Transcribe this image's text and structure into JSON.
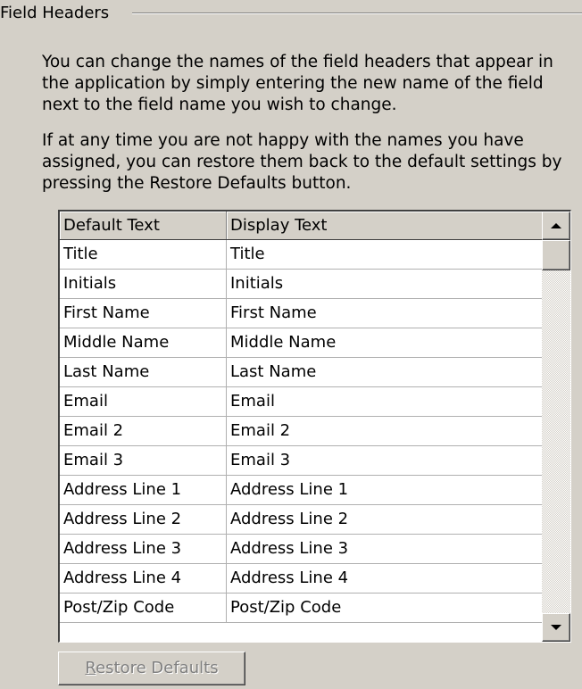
{
  "group": {
    "title": "Field Headers"
  },
  "instructions": {
    "p1": "You can change the names of the field headers that appear in\nthe application by simply entering the new name of the field\nnext to the field name you wish to change.",
    "p2": "If at any time you are not happy with the names you have\nassigned, you can restore them back to the default settings by\npressing the Restore Defaults button."
  },
  "grid": {
    "columns": [
      "Default Text",
      "Display Text"
    ],
    "rows": [
      [
        "Title",
        "Title"
      ],
      [
        "Initials",
        "Initials"
      ],
      [
        "First Name",
        "First Name"
      ],
      [
        "Middle Name",
        "Middle Name"
      ],
      [
        "Last Name",
        "Last Name"
      ],
      [
        "Email",
        "Email"
      ],
      [
        "Email 2",
        "Email 2"
      ],
      [
        "Email 3",
        "Email 3"
      ],
      [
        "Address Line 1",
        "Address Line 1"
      ],
      [
        "Address Line 2",
        "Address Line 2"
      ],
      [
        "Address Line 3",
        "Address Line 3"
      ],
      [
        "Address Line 4",
        "Address Line 4"
      ],
      [
        "Post/Zip Code",
        "Post/Zip Code"
      ]
    ]
  },
  "buttons": {
    "restore_defaults": "Restore Defaults",
    "restore_enabled": false
  },
  "colors": {
    "face": "#d4d0c8",
    "grid_bg": "#ffffff",
    "disabled_text": "#808080"
  }
}
